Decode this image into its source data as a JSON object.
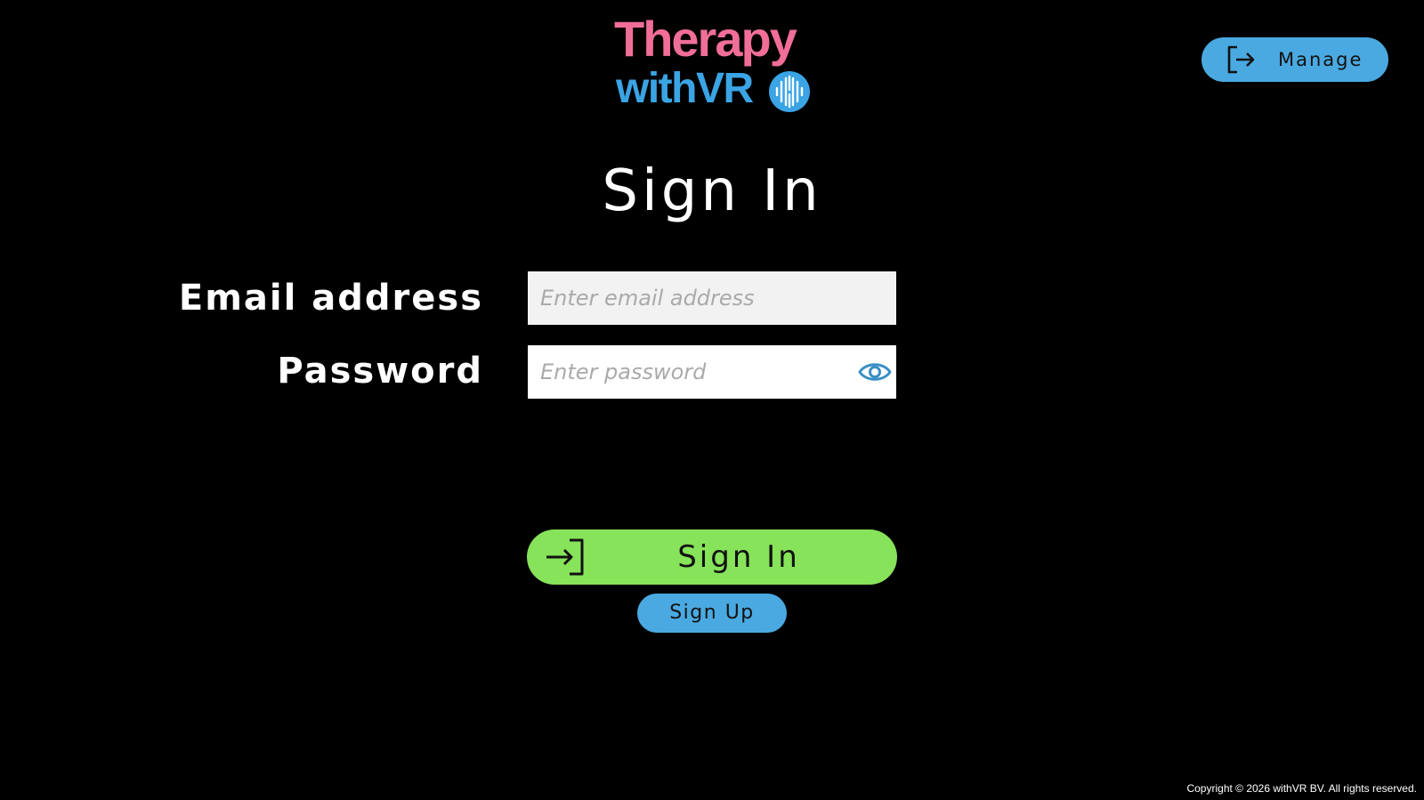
{
  "brand": {
    "line1": "Therapy",
    "line2": "withVR",
    "colors": {
      "therapy": "#f06e98",
      "withvr": "#3aa4e4"
    }
  },
  "header": {
    "manage_label": "Manage",
    "manage_icon": "logout-icon"
  },
  "page": {
    "title": "Sign In"
  },
  "form": {
    "email": {
      "label": "Email address",
      "placeholder": "Enter email address",
      "value": ""
    },
    "password": {
      "label": "Password",
      "placeholder": "Enter password",
      "value": "",
      "toggle_icon": "eye-icon"
    }
  },
  "actions": {
    "signin_label": "Sign In",
    "signin_icon": "login-icon",
    "signup_label": "Sign Up"
  },
  "footer": {
    "copyright": "Copyright © 2026 withVR BV. All rights reserved."
  },
  "theme": {
    "background": "#000000",
    "signin_green": "#86e35a",
    "accent_blue": "#4aa9e0"
  }
}
